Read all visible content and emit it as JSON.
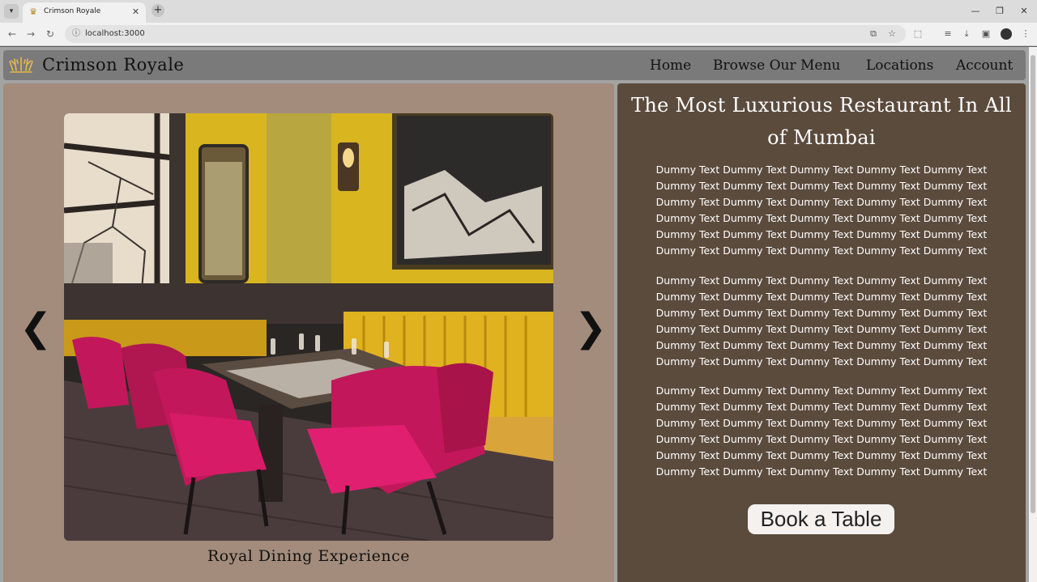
{
  "browser": {
    "tab_title": "Crimson Royale",
    "url": "localhost:3000",
    "new_tab_symbol": "+",
    "close_symbol": "✕"
  },
  "site": {
    "brand": "Crimson Royale",
    "nav": [
      {
        "label": "Home"
      },
      {
        "label": "Browse Our Menu"
      },
      {
        "label": "Locations"
      },
      {
        "label": "Account"
      }
    ]
  },
  "carousel": {
    "prev_symbol": "❮",
    "next_symbol": "❯",
    "caption": "Royal Dining Experience"
  },
  "about": {
    "headline_line1": "The Most Luxurious Restaurant In All",
    "headline_line2": "of Mumbai",
    "paragraphs": [
      "Dummy Text Dummy Text Dummy Text Dummy Text Dummy Text Dummy Text Dummy Text Dummy Text Dummy Text Dummy Text Dummy Text Dummy Text Dummy Text Dummy Text Dummy Text Dummy Text Dummy Text Dummy Text Dummy Text Dummy Text Dummy Text Dummy Text Dummy Text Dummy Text Dummy Text Dummy Text Dummy Text Dummy Text Dummy Text Dummy Text",
      "Dummy Text Dummy Text Dummy Text Dummy Text Dummy Text Dummy Text Dummy Text Dummy Text Dummy Text Dummy Text Dummy Text Dummy Text Dummy Text Dummy Text Dummy Text Dummy Text Dummy Text Dummy Text Dummy Text Dummy Text Dummy Text Dummy Text Dummy Text Dummy Text Dummy Text Dummy Text Dummy Text Dummy Text Dummy Text Dummy Text",
      "Dummy Text Dummy Text Dummy Text Dummy Text Dummy Text Dummy Text Dummy Text Dummy Text Dummy Text Dummy Text Dummy Text Dummy Text Dummy Text Dummy Text Dummy Text Dummy Text Dummy Text Dummy Text Dummy Text Dummy Text Dummy Text Dummy Text Dummy Text Dummy Text Dummy Text Dummy Text Dummy Text Dummy Text Dummy Text Dummy Text"
    ],
    "book_button": "Book a Table"
  },
  "colors": {
    "navbar": "#7a7a7a",
    "left_panel": "#a38c7c",
    "right_panel": "#5b4b3d",
    "chair": "#c2185b",
    "banquette": "#e0b21f"
  },
  "icons": [
    "tab-list-icon",
    "crown-logo-icon",
    "back-icon",
    "forward-icon",
    "reload-icon",
    "info-icon",
    "install-icon",
    "star-icon",
    "extensions-icon",
    "media-icon",
    "download-icon",
    "sidepanel-icon",
    "profile-icon",
    "menu-icon"
  ]
}
